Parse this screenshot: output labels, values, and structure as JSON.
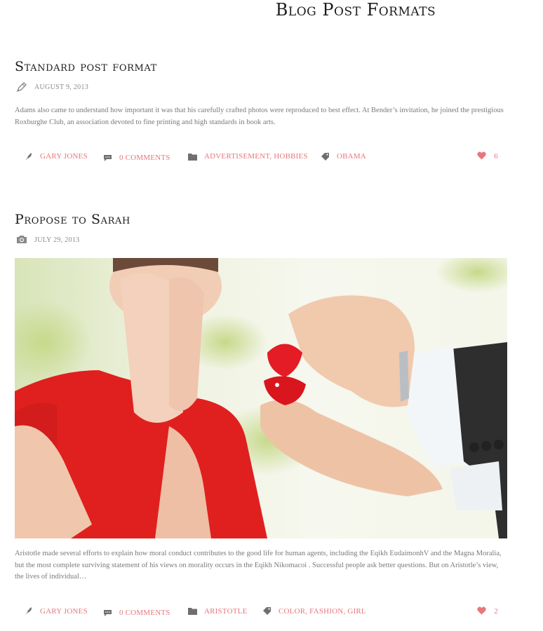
{
  "page": {
    "title": "Blog Post Formats"
  },
  "posts": [
    {
      "title": "Standard post format",
      "format_icon": "pencil-icon",
      "date": "August 9, 2013",
      "excerpt": "Adams also came to understand how important it was that his carefully crafted photos were reproduced to best effect. At Bender’s invitation, he joined the prestigious Roxburghe Club, an association devoted to fine printing and high standards in book arts.",
      "author": "Gary Jones",
      "comments": "0 Comments",
      "categories": "Advertisement, Hobbies",
      "tags": "Obama",
      "likes": "6"
    },
    {
      "title": "Propose to Sarah",
      "format_icon": "camera-icon",
      "date": "July 29, 2013",
      "excerpt": "Aristotle made several efforts to explain how moral conduct contributes to the good life for human agents, including the Eqikh EudaimonhV and the Magna Moralia, but the most complete surviving statement of his views on morality occurs in the Eqikh Nikomacoi . Successful people ask better questions. But on Aristotle’s view, the lives of individual…",
      "author": "Gary Jones",
      "comments": "0 Comments",
      "categories": "Aristotle",
      "tags": "Color, Fashion, Girl",
      "likes": "2"
    }
  ],
  "colors": {
    "accent": "#e8767d",
    "muted_text": "#7a7a7a",
    "icon_gray": "#6f6f6f"
  }
}
